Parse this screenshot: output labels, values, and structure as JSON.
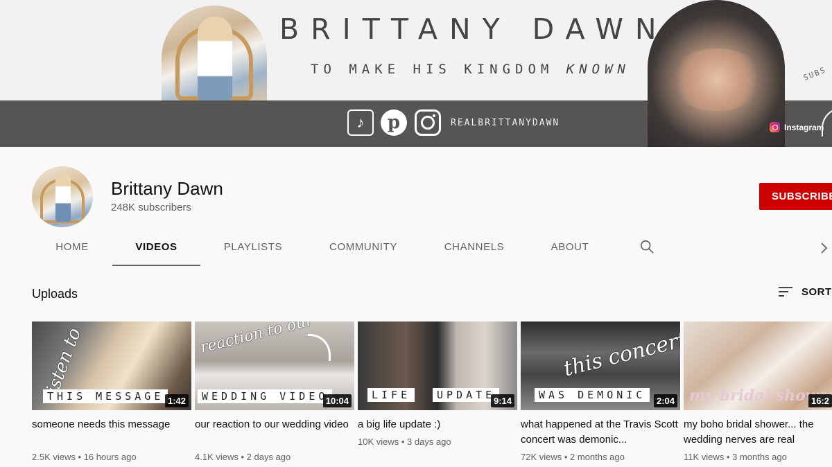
{
  "banner": {
    "title": "BRITTANY DAWN",
    "tagline_main": "TO MAKE HIS KINGDOM ",
    "tagline_emphasis": "KNOWN",
    "handle": "REALBRITTANYDAWN",
    "subs_text": "SUBS",
    "instagram_link": "Instagram",
    "social_icons": [
      "tiktok-icon",
      "pinterest-icon",
      "instagram-icon"
    ]
  },
  "channel": {
    "name": "Brittany Dawn",
    "subscribers": "248K subscribers",
    "subscribe_label": "SUBSCRIBE"
  },
  "tabs": [
    {
      "label": "HOME",
      "active": false
    },
    {
      "label": "VIDEOS",
      "active": true
    },
    {
      "label": "PLAYLISTS",
      "active": false
    },
    {
      "label": "COMMUNITY",
      "active": false
    },
    {
      "label": "CHANNELS",
      "active": false
    },
    {
      "label": "ABOUT",
      "active": false
    }
  ],
  "section": {
    "title": "Uploads",
    "sort_label": "SORT"
  },
  "videos": [
    {
      "title": "someone needs this message",
      "views": "2.5K views",
      "age": "16 hours ago",
      "duration": "1:42",
      "thumb_caption": "THIS MESSAGE",
      "thumb_script": "listen to"
    },
    {
      "title": "our reaction to our wedding video",
      "views": "4.1K views",
      "age": "2 days ago",
      "duration": "10:04",
      "thumb_caption": "WEDDING VIDEO",
      "thumb_script": "reaction to our"
    },
    {
      "title": "a big life update :)",
      "views": "10K views",
      "age": "3 days ago",
      "duration": "9:14",
      "thumb_caption_left": "LIFE",
      "thumb_caption_right": "UPDATE"
    },
    {
      "title": "what happened at the Travis Scott concert was demonic...",
      "views": "72K views",
      "age": "2 months ago",
      "duration": "2:04",
      "thumb_caption": "WAS DEMONIC",
      "thumb_script": "this concert"
    },
    {
      "title": "my boho bridal shower... the wedding nerves are real",
      "views": "11K views",
      "age": "3 months ago",
      "duration": "16:2",
      "thumb_script": "my bridal shower"
    }
  ],
  "colors": {
    "subscribe_red": "#cc0000",
    "banner_strip": "#555555",
    "secondary_text": "#606060"
  }
}
